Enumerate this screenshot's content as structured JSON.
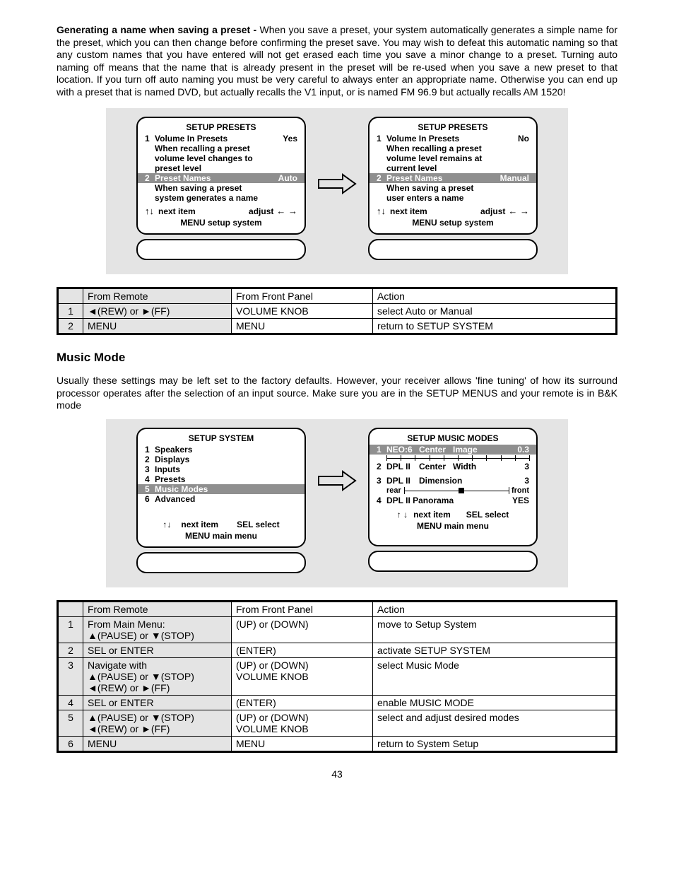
{
  "intro": {
    "heading": "Generating a name when saving a preset - ",
    "body": "When you save a preset, your system automatically generates a simple name for the preset, which you can then change before confirming the preset save. You may wish to defeat this automatic naming so that any custom names that you have entered will not get erased each time you save a minor change to a preset. Turning auto naming off means that the name that is already present in the preset will be re-used when you save a new preset to that location. If you turn off auto naming you must be very careful to always enter an appropriate name. Otherwise you can end up with a preset that is named DVD, but actually recalls the V1 input, or is named FM 96.9 but actually recalls AM 1520!"
  },
  "presets": {
    "left": {
      "title": "SETUP PRESETS",
      "row1_num": "1",
      "row1_label": "Volume In Presets",
      "row1_val": "Yes",
      "desc1a": "When recalling a preset",
      "desc1b": "volume level changes to",
      "desc1c": "preset level",
      "row2_num": "2",
      "row2_label": "Preset Names",
      "row2_val": "Auto",
      "desc2a": "When saving a preset",
      "desc2b": "system generates a name",
      "nav_next": "next item",
      "nav_adjust": "adjust",
      "foot": "MENU setup system"
    },
    "right": {
      "title": "SETUP PRESETS",
      "row1_num": "1",
      "row1_label": "Volume In Presets",
      "row1_val": "No",
      "desc1a": "When recalling a preset",
      "desc1b": "volume level remains at",
      "desc1c": "current level",
      "row2_num": "2",
      "row2_label": "Preset Names",
      "row2_val": "Manual",
      "desc2a": "When saving a preset",
      "desc2b": "user enters a name",
      "nav_next": "next item",
      "nav_adjust": "adjust",
      "foot": "MENU setup system"
    }
  },
  "table1": {
    "h1": "From Remote",
    "h2": "From Front Panel",
    "h3": "Action",
    "rows": [
      {
        "n": "1",
        "remote": "◄(REW) or ►(FF)",
        "front": "VOLUME KNOB",
        "action": "select Auto or Manual"
      },
      {
        "n": "2",
        "remote": "MENU",
        "front": "MENU",
        "action": "return to SETUP SYSTEM"
      }
    ]
  },
  "music": {
    "heading": "Music Mode",
    "body": "Usually these settings may be left set to the factory defaults. However, your receiver allows 'fine tuning' of how its surround processor operates after the selection of an input source. Make sure you are in the SETUP MENUS and your remote is in B&K mode"
  },
  "system_panel": {
    "title": "SETUP SYSTEM",
    "items": [
      {
        "n": "1",
        "l": "Speakers"
      },
      {
        "n": "2",
        "l": "Displays"
      },
      {
        "n": "3",
        "l": "Inputs"
      },
      {
        "n": "4",
        "l": "Presets"
      },
      {
        "n": "5",
        "l": "Music Modes"
      },
      {
        "n": "6",
        "l": "Advanced"
      }
    ],
    "nav_next": "next item",
    "nav_sel": "SEL  select",
    "foot": "MENU main menu"
  },
  "music_panel": {
    "title": "SETUP MUSIC MODES",
    "r1": {
      "n": "1",
      "a": "NEO:6",
      "b": "Center",
      "c": "Image",
      "v": "0.3"
    },
    "r2": {
      "n": "2",
      "a": "DPL II",
      "b": "Center",
      "c": "Width",
      "v": "3"
    },
    "r3": {
      "n": "3",
      "a": "DPL II",
      "b": "Dimension",
      "v": "3"
    },
    "slider": {
      "left": "rear",
      "right": "front"
    },
    "r4": {
      "n": "4",
      "a": "DPL II Panorama",
      "v": "YES"
    },
    "nav_next": "next item",
    "nav_sel": "SEL  select",
    "foot": "MENU main menu"
  },
  "table2": {
    "h1": "From Remote",
    "h2": "From Front Panel",
    "h3": "Action",
    "rows": [
      {
        "n": "1",
        "remote": "From Main Menu:\n▲(PAUSE) or ▼(STOP)",
        "front": "(UP) or (DOWN)",
        "action": "move to Setup System"
      },
      {
        "n": "2",
        "remote": "SEL or ENTER",
        "front": "(ENTER)",
        "action": "activate SETUP SYSTEM"
      },
      {
        "n": "3",
        "remote": "Navigate with\n▲(PAUSE) or ▼(STOP)\n◄(REW) or ►(FF)",
        "front": "(UP) or (DOWN)\nVOLUME KNOB",
        "action": "select Music Mode"
      },
      {
        "n": "4",
        "remote": "SEL or ENTER",
        "front": "(ENTER)",
        "action": "enable MUSIC MODE"
      },
      {
        "n": "5",
        "remote": "▲(PAUSE) or ▼(STOP)\n◄(REW) or ►(FF)",
        "front": "(UP) or (DOWN)\nVOLUME KNOB",
        "action": "select and adjust desired modes"
      },
      {
        "n": "6",
        "remote": "MENU",
        "front": "MENU",
        "action": "return to System Setup"
      }
    ]
  },
  "page_number": "43"
}
